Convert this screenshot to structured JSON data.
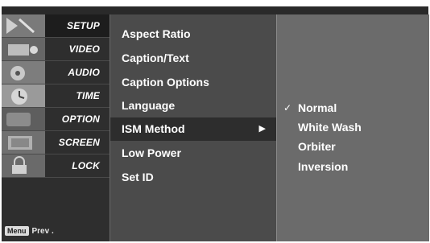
{
  "categories": [
    {
      "label": "SETUP",
      "icon": "setup-icon",
      "active": true
    },
    {
      "label": "VIDEO",
      "icon": "video-icon"
    },
    {
      "label": "AUDIO",
      "icon": "audio-icon"
    },
    {
      "label": "TIME",
      "icon": "time-icon"
    },
    {
      "label": "OPTION",
      "icon": "option-icon"
    },
    {
      "label": "SCREEN",
      "icon": "screen-icon"
    },
    {
      "label": "LOCK",
      "icon": "lock-icon"
    }
  ],
  "footer": {
    "key_label": "Menu",
    "text": "Prev ."
  },
  "menu_items": [
    {
      "label": "Aspect Ratio"
    },
    {
      "label": "Caption/Text"
    },
    {
      "label": "Caption Options"
    },
    {
      "label": "Language"
    },
    {
      "label": "ISM Method",
      "selected": true,
      "arrow": "▶"
    },
    {
      "label": "Low Power"
    },
    {
      "label": "Set ID"
    }
  ],
  "options": [
    {
      "label": "Normal",
      "checked": true,
      "check": "✓"
    },
    {
      "label": "White Wash"
    },
    {
      "label": "Orbiter"
    },
    {
      "label": "Inversion"
    }
  ],
  "colors": {
    "left_column": "#2e2e2e",
    "middle_panel": "#4b4b4b",
    "right_panel": "#6b6b6b",
    "selected_row": "#2d2d2d",
    "text": "#ffffff"
  }
}
